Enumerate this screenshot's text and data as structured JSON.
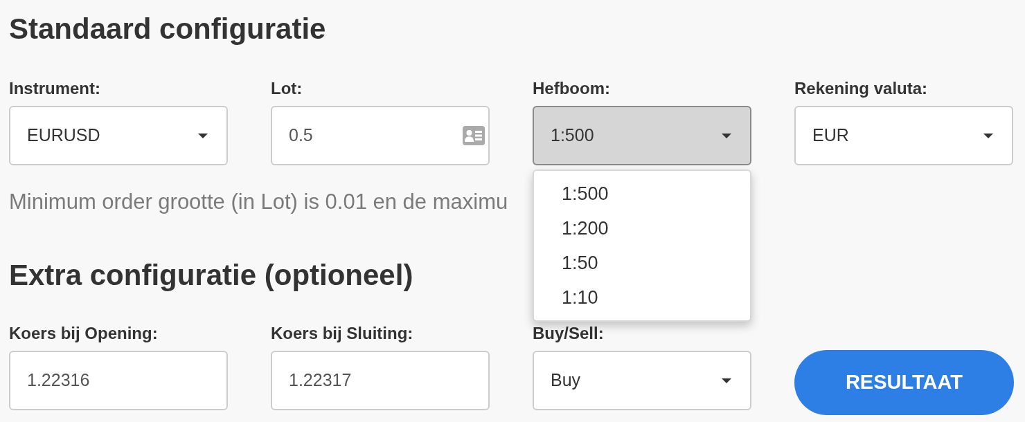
{
  "sections": [
    {
      "title": "Standaard configuratie",
      "fields": [
        {
          "label": "Instrument:",
          "kind": "select",
          "value": "EURUSD",
          "expanded": false
        },
        {
          "label": "Lot:",
          "kind": "input_card",
          "value": "0.5",
          "expanded": false
        },
        {
          "label": "Hefboom:",
          "kind": "select",
          "value": "1:500",
          "expanded": true,
          "options": [
            "1:500",
            "1:200",
            "1:50",
            "1:10"
          ]
        },
        {
          "label": "Rekening valuta:",
          "kind": "select",
          "value": "EUR",
          "expanded": false
        }
      ],
      "hint": "Minimum order grootte (in Lot) is 0.01 en de maximu"
    },
    {
      "title": "Extra configuratie (optioneel)",
      "fields": [
        {
          "label": "Koers bij Opening:",
          "kind": "input",
          "value": "1.22316",
          "expanded": false
        },
        {
          "label": "Koers bij Sluiting:",
          "kind": "input",
          "value": "1.22317",
          "expanded": false
        },
        {
          "label": "Buy/Sell:",
          "kind": "select",
          "value": "Buy",
          "expanded": false
        }
      ],
      "button": "RESULTAAT"
    }
  ]
}
